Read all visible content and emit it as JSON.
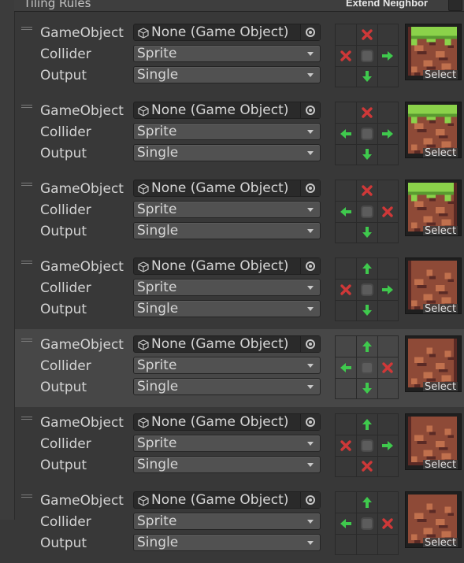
{
  "header": {
    "title": "Tiling Rules",
    "extend_neighbor": "Extend Neighbor"
  },
  "colors": {
    "green": "#3fc94d",
    "red": "#cf3838",
    "panel": "#383838",
    "selected": "#474747"
  },
  "labels": {
    "gameobject": "GameObject",
    "collider": "Collider",
    "output": "Output",
    "select": "Select"
  },
  "rules": [
    {
      "gameobject": "None (Game Object)",
      "collider": "Sprite",
      "output": "Single",
      "neighbors": [
        "",
        "x",
        "",
        "x",
        "",
        "arrow-right",
        "",
        "arrow-down",
        ""
      ],
      "sprite": "grass-top",
      "selected": false
    },
    {
      "gameobject": "None (Game Object)",
      "collider": "Sprite",
      "output": "Single",
      "neighbors": [
        "",
        "x",
        "",
        "arrow-left",
        "",
        "arrow-right",
        "",
        "arrow-down",
        ""
      ],
      "sprite": "grass-top-mid",
      "selected": false
    },
    {
      "gameobject": "None (Game Object)",
      "collider": "Sprite",
      "output": "Single",
      "neighbors": [
        "",
        "x",
        "",
        "arrow-left",
        "",
        "x",
        "",
        "arrow-down",
        ""
      ],
      "sprite": "grass-top-right",
      "selected": false
    },
    {
      "gameobject": "None (Game Object)",
      "collider": "Sprite",
      "output": "Single",
      "neighbors": [
        "",
        "arrow-up",
        "",
        "x",
        "",
        "arrow-right",
        "",
        "arrow-down",
        ""
      ],
      "sprite": "dirt-left",
      "selected": false
    },
    {
      "gameobject": "None (Game Object)",
      "collider": "Sprite",
      "output": "Single",
      "neighbors": [
        "",
        "arrow-up",
        "",
        "arrow-left",
        "",
        "x",
        "",
        "arrow-down",
        ""
      ],
      "sprite": "dirt-right",
      "selected": true
    },
    {
      "gameobject": "None (Game Object)",
      "collider": "Sprite",
      "output": "Single",
      "neighbors": [
        "",
        "arrow-up",
        "",
        "x",
        "",
        "arrow-right",
        "",
        "x",
        ""
      ],
      "sprite": "dirt-bottom-left",
      "selected": false
    },
    {
      "gameobject": "None (Game Object)",
      "collider": "Sprite",
      "output": "Single",
      "neighbors": [
        "",
        "arrow-up",
        "",
        "arrow-left",
        "",
        "x",
        "",
        "",
        ""
      ],
      "sprite": "dirt-partial",
      "selected": false
    }
  ]
}
